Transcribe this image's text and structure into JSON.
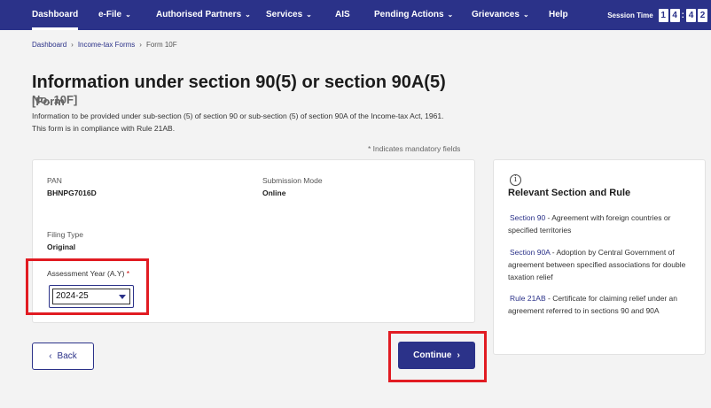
{
  "nav": {
    "items": [
      {
        "label": "Dashboard",
        "has_menu": false
      },
      {
        "label": "e-File",
        "has_menu": true
      },
      {
        "label": "Authorised Partners",
        "has_menu": true
      },
      {
        "label": "Services",
        "has_menu": true
      },
      {
        "label": "AIS",
        "has_menu": false
      },
      {
        "label": "Pending Actions",
        "has_menu": true
      },
      {
        "label": "Grievances",
        "has_menu": true
      },
      {
        "label": "Help",
        "has_menu": false
      }
    ],
    "active_item": "Dashboard",
    "session_label": "Session Time",
    "session_digits": [
      "1",
      "4",
      "4",
      "2"
    ]
  },
  "breadcrumb": {
    "items": [
      "Dashboard",
      "Income-tax Forms",
      "Form 10F"
    ]
  },
  "page": {
    "title": "Information under section 90(5) or section 90A(5)",
    "form_tag_part1": "[Form",
    "form_tag_part2": "No. 10F]",
    "description": "Information to be provided under sub-section (5) of section 90 or sub-section (5) of section 90A of the Income-tax Act, 1961. This form is in compliance with Rule 21AB.",
    "mandatory_note": "* Indicates mandatory fields"
  },
  "form": {
    "pan_label": "PAN",
    "pan_value": "BHNPG7016D",
    "submission_mode_label": "Submission Mode",
    "submission_mode_value": "Online",
    "filing_type_label": "Filing Type",
    "filing_type_value": "Original",
    "assessment_year_label": "Assessment Year (A.Y)",
    "assessment_year_required": "*",
    "assessment_year_value": "2024-25"
  },
  "side": {
    "title": "Relevant Section and Rule",
    "rules": [
      {
        "link": "Section 90",
        "text": " - Agreement with foreign countries or specified territories"
      },
      {
        "link": "Section 90A",
        "text": " - Adoption by Central Government of agreement between specified associations for double taxation relief"
      },
      {
        "link": "Rule 21AB",
        "text": " - Certificate for claiming relief under an agreement referred to in sections 90 and 90A"
      }
    ]
  },
  "buttons": {
    "back_label": "Back",
    "continue_label": "Continue"
  },
  "icons": {
    "info": "info-icon",
    "chevron_down": "chevron-down-icon",
    "chevron_left": "chevron-left-icon",
    "chevron_right": "chevron-right-icon"
  },
  "colors": {
    "brand": "#2b3289",
    "highlight": "#e11b22"
  }
}
